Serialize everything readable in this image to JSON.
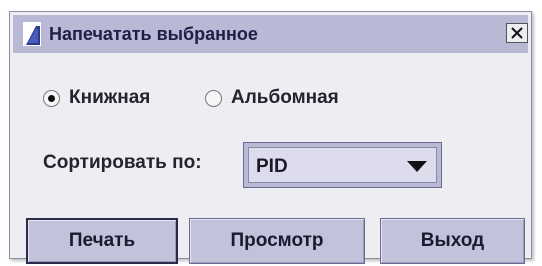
{
  "window": {
    "title": "Напечатать выбранное",
    "close_label": "X"
  },
  "orientation": {
    "options": [
      {
        "label": "Книжная",
        "selected": true
      },
      {
        "label": "Альбомная",
        "selected": false
      }
    ]
  },
  "sort": {
    "label": "Сортировать по:",
    "value": "PID"
  },
  "buttons": {
    "print": "Печать",
    "preview": "Просмотр",
    "exit": "Выход"
  },
  "colors": {
    "titlebar": "#b9b9d6",
    "dialog_bg": "#eeeef2",
    "button_bg": "#c2c2db",
    "text": "#1e1e48"
  },
  "icons": {
    "app": "java-cup-icon",
    "close": "close-icon",
    "dropdown": "triangle-down-icon"
  }
}
